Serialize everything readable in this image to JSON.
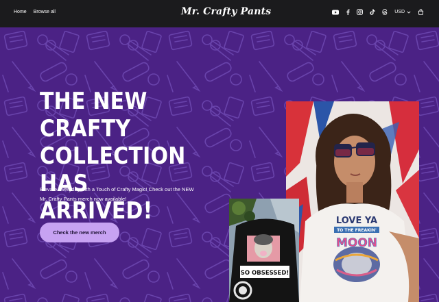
{
  "header": {
    "nav": [
      "Home",
      "Browse all"
    ],
    "logo": "Mr. Crafty Pants",
    "currency": "USD",
    "social_icons": [
      "youtube-icon",
      "facebook-icon",
      "instagram-icon",
      "tiktok-icon",
      "threads-icon"
    ]
  },
  "hero": {
    "headline_lines": [
      "THE NEW CRAFTY",
      "COLLECTION HAS",
      "ARRIVED!"
    ],
    "subtext_lines": [
      "Elevate Everyday with a Touch of Crafty Magic! Check out the NEW",
      "Mr. Crafty Pants merch now available!"
    ],
    "cta_label": "Check the new merch"
  },
  "merch": {
    "shirt_main_lines": [
      "LOVE YA",
      "TO THE FREAKIN'",
      "MOON"
    ],
    "shirt_small": "SO OBSESSED!"
  },
  "colors": {
    "topbar": "#1b1b1d",
    "hero_bg": "#4e2489",
    "pattern": "#7a55c4",
    "cta": "#c7a2f2"
  }
}
